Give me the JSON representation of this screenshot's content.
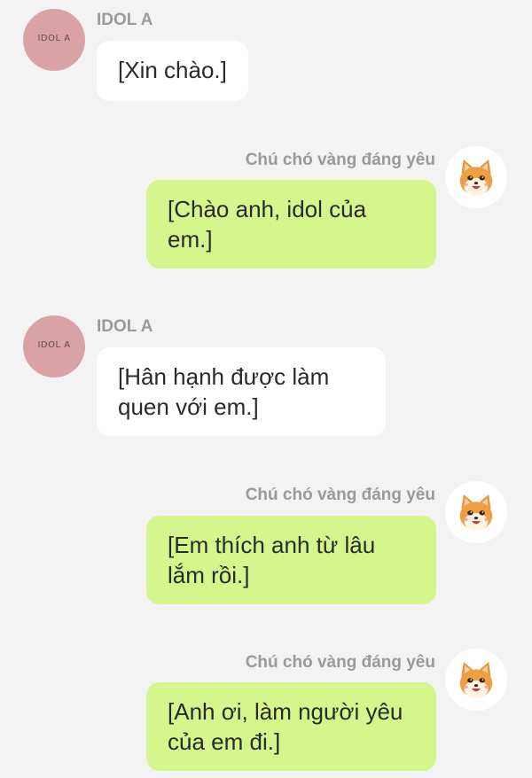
{
  "messages": [
    {
      "side": "left",
      "sender": "IDOL A",
      "avatar_text": "IDOL A",
      "text": "[Xin chào.]"
    },
    {
      "side": "right",
      "sender": "Chú chó vàng đáng yêu",
      "avatar_icon": "shiba-dog-icon",
      "text": "[Chào anh, idol của em.]"
    },
    {
      "side": "left",
      "sender": "IDOL A",
      "avatar_text": "IDOL A",
      "text": "[Hân hạnh được làm quen với em.]"
    },
    {
      "side": "right",
      "sender": "Chú chó vàng đáng yêu",
      "avatar_icon": "shiba-dog-icon",
      "text": "[Em thích anh từ lâu lắm rồi.]"
    },
    {
      "side": "right",
      "sender": "Chú chó vàng đáng yêu",
      "avatar_icon": "shiba-dog-icon",
      "text": "[Anh ơi, làm người yêu của em đi.]"
    }
  ],
  "colors": {
    "background": "#f3f3f3",
    "left_bubble": "#ffffff",
    "right_bubble": "#d5f58d",
    "left_avatar": "#d9a3a6",
    "sender_name": "#9a9a9a"
  }
}
